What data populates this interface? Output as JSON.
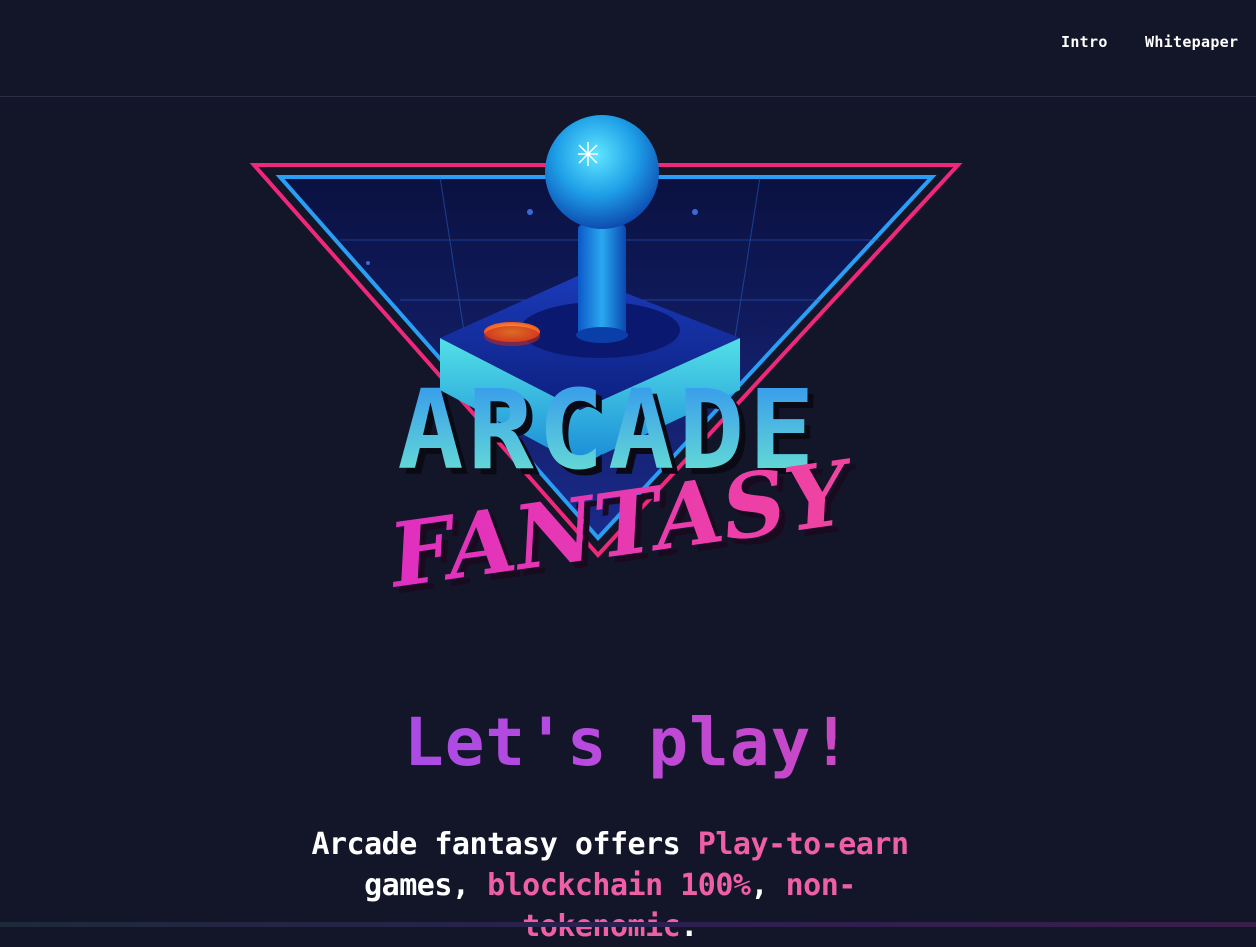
{
  "nav": {
    "intro": "Intro",
    "whitepaper": "Whitepaper"
  },
  "logo": {
    "word_top": "ARCADE",
    "word_bottom": "FANTASY"
  },
  "hero": {
    "headline": "Let's play!",
    "tagline_part1": "Arcade fantasy offers ",
    "tagline_hl1": "Play-to-earn",
    "tagline_part2": " games, ",
    "tagline_hl2": "blockchain 100%",
    "tagline_part3": ", ",
    "tagline_hl3": "non-tokenomic",
    "tagline_part4": "."
  },
  "colors": {
    "background": "#121628",
    "accent_pink": "#ef5fa7",
    "accent_purple": "#8e4ff0",
    "logo_blue": "#2a9df4",
    "logo_teal": "#5fe0d0"
  }
}
